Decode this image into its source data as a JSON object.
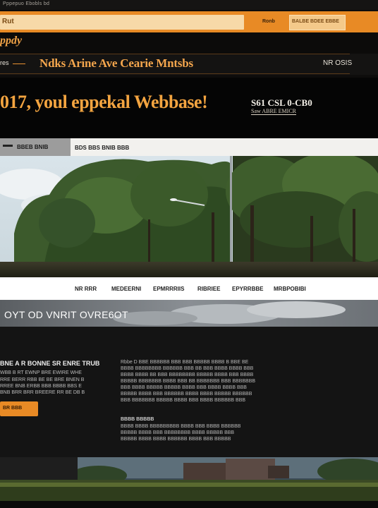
{
  "top_bar": {
    "text": "Pppepuo Ebobls bd"
  },
  "header": {
    "search_value": "Rut",
    "nav_link": "Ronb",
    "button_label": "BALBE BDEE EBBE"
  },
  "logo": {
    "text": "ppdy"
  },
  "title_strip": {
    "left_label": "res",
    "site_title": "Ndks Arine Ave Cearie Mntsbs",
    "right_label": "NR OSIS"
  },
  "hero": {
    "title": "017, youl eppekal Webbase!",
    "right_line1": "S61 CSL 0-CB0",
    "right_line2": "Saw  ABRE  EMICR"
  },
  "tabs": {
    "active_label": "BBEB BNIB",
    "second_label": "BDS BBS BNIB BBB"
  },
  "nav": {
    "items": [
      "NR RRR",
      "MEDEERNI",
      "EPMRRRIIS",
      "RIBRIEE",
      "EPYRRBBE",
      "MRBPOBIBI"
    ]
  },
  "banner": {
    "text": "OYT OD VNRIT OVRE6OT"
  },
  "content": {
    "left_heading": "BNE A R BONNE SR ENRE TRUB",
    "left_lines": [
      "WBB B RT EWNP BRE EWIRE WHE",
      "RRE BERR RBB BE BE BRE BNEN B",
      "RREE BNB ERBB BBB BBBB BBS E",
      "BNB BRR BRR BREERE RR BE DB B"
    ],
    "button_label": "BR BBB",
    "right_lines": [
      "Rbbe D BBE BBBBBB BBB BBB BBBBB BBBB B BBE BE",
      "BBBB BBBBBBBB BBBBBB BBB BB BBB BBBB BBBB BBB",
      "BBBB BBBB BB BBB BBBBBBBB BBBBB BBBB BBB BBBB",
      "BBBBB BBBBBBB BBBB BBB BB BBBBBBB BBB BBBBBBB",
      "BBB BBBB BBBBB BBBBB BBBB BBB BBBB BBBB BBB",
      "BBBBB BBBB BBB BBBBBB BBBB BBBB BBBBB BBBBBB",
      "BBB BBBBBBB BBBBB BBBB BBB BBBB BBBBBB BBB"
    ],
    "right_subheading": "BBBB BBBBB",
    "right_lines2": [
      "BBBB BBBB BBBBBBBBB BBBB BBB BBBB BBBBBB",
      "BBBBB BBBB BBB BBBBBBBB BBBB BBBBB BBB",
      "BBBBB BBBB BBBB BBBBBB BBBB BBB BBBBB"
    ]
  },
  "colors": {
    "accent": "#e88a25",
    "accent_text": "#f4a64d",
    "background": "#0e0d0c"
  }
}
